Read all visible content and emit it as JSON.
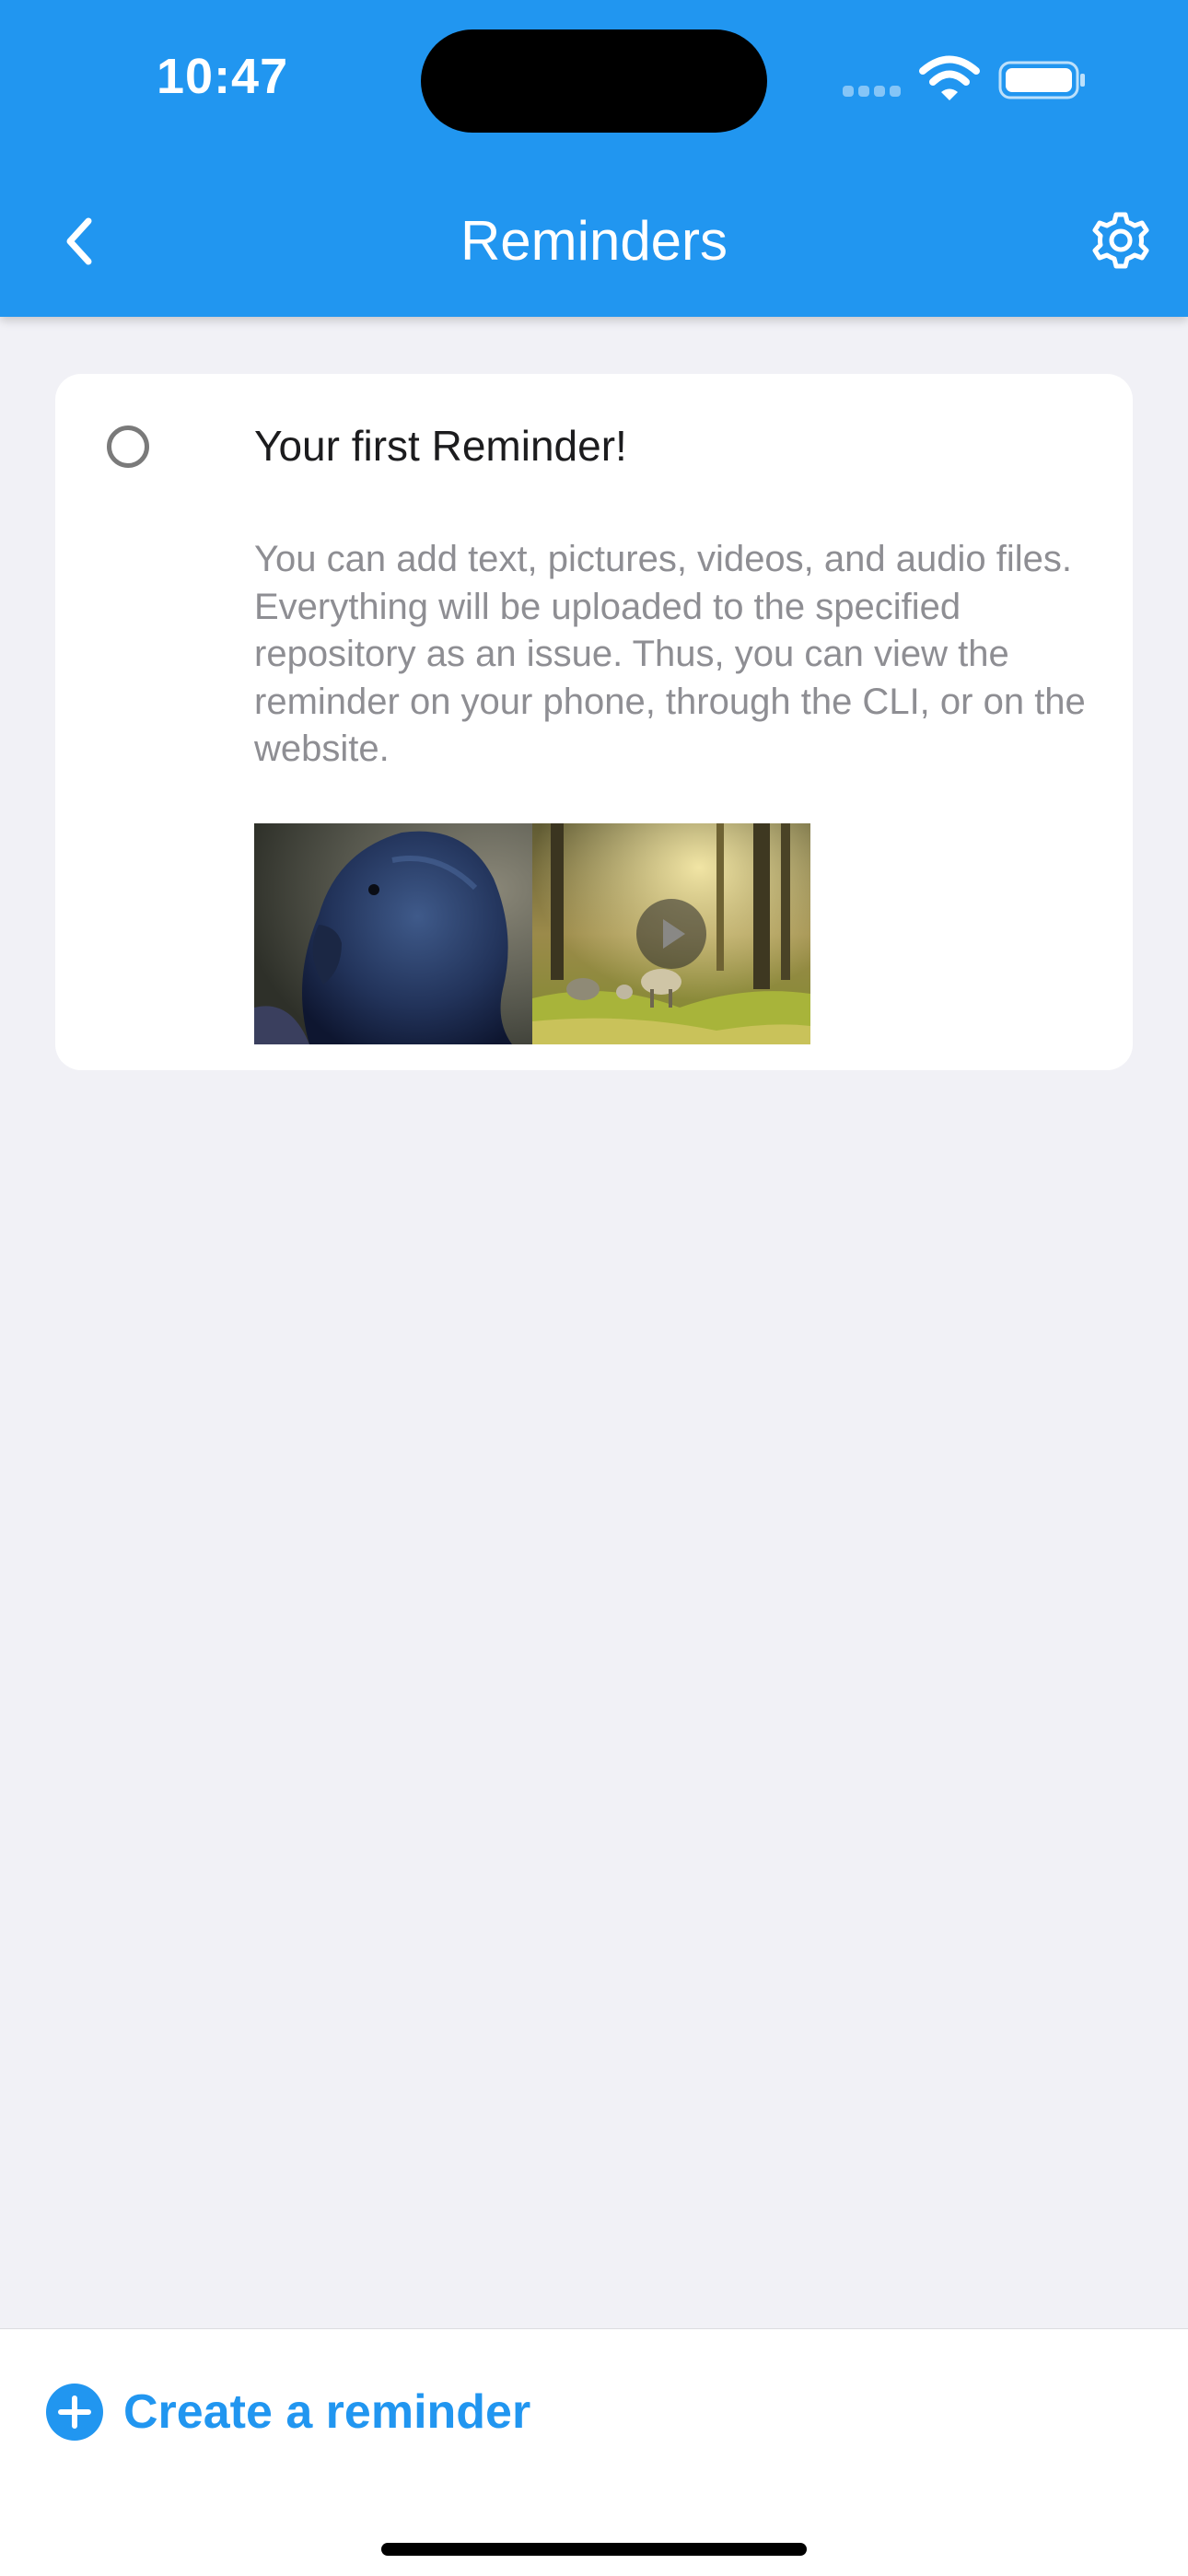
{
  "status_bar": {
    "time": "10:47"
  },
  "nav": {
    "title": "Reminders",
    "back_icon": "chevron-left-icon",
    "settings_icon": "gear-icon"
  },
  "reminders": [
    {
      "title": "Your first Reminder!",
      "description": "You can add text, pictures, videos, and audio files. Everything will be uploaded to the specified repository as an issue. Thus, you can view the reminder on your phone, through the CLI, or on the website.",
      "completed": false,
      "attachments": [
        {
          "kind": "image",
          "subject": "parrot-photo"
        },
        {
          "kind": "video",
          "subject": "forest-sheep-video"
        }
      ]
    }
  ],
  "bottom_bar": {
    "create_label": "Create a reminder",
    "create_icon": "plus-circle-icon"
  },
  "colors": {
    "accent": "#2196f0",
    "background": "#f1f1f6",
    "card": "#ffffff",
    "secondary_text": "#8e8e93"
  }
}
